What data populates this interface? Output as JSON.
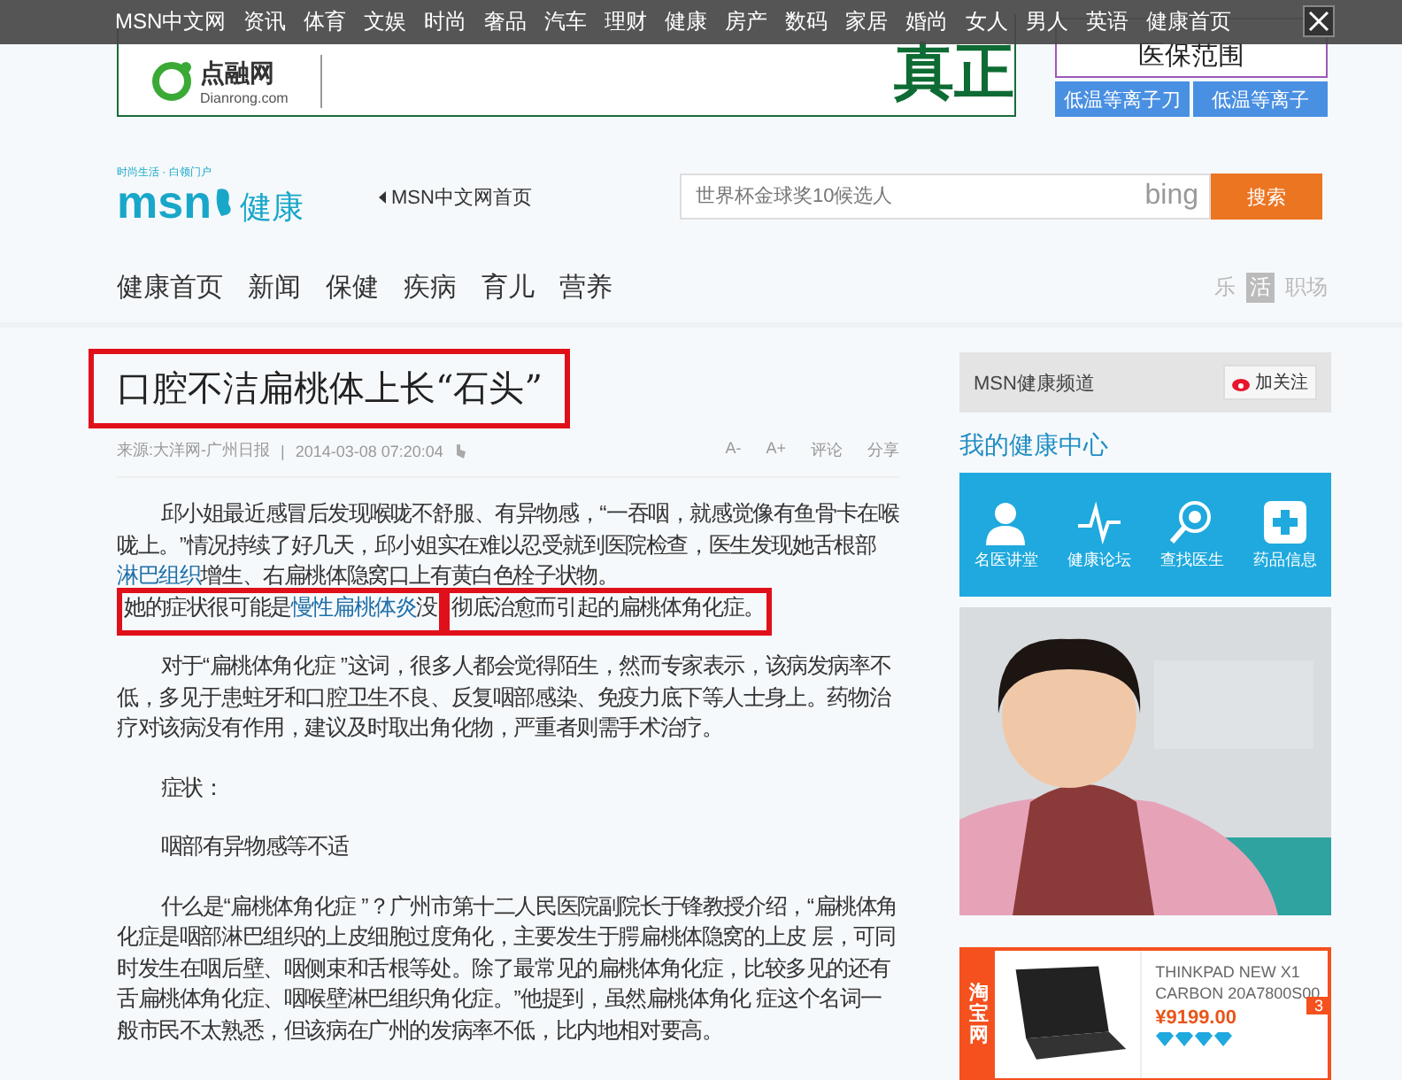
{
  "top_bar": {
    "links": [
      "MSN中文网",
      "资讯",
      "体育",
      "文娱",
      "时尚",
      "奢品",
      "汽车",
      "理财",
      "健康",
      "房产",
      "数码",
      "家居",
      "婚尚",
      "女人",
      "男人",
      "英语",
      "健康首页"
    ]
  },
  "ad_banner": {
    "brand": "点融网",
    "domain": "Dianrong.com",
    "headline": "真正"
  },
  "side_ad": {
    "title": "医保范围",
    "buttons": [
      "低温等离子刀",
      "低温等离子"
    ]
  },
  "header": {
    "tagline": "时尚生活 · 白领门户",
    "logo": "msn",
    "channel": "健康",
    "home_link": "MSN中文网首页",
    "search": {
      "placeholder": "世界杯金球奖10候选人",
      "engine": "bing",
      "button": "搜索"
    }
  },
  "nav": {
    "items": [
      "健康首页",
      "新闻",
      "保健",
      "疾病",
      "育儿",
      "营养"
    ],
    "tabs": [
      {
        "label": "乐",
        "selected": false
      },
      {
        "label": "活",
        "selected": true
      },
      {
        "label": "职场",
        "selected": false
      }
    ]
  },
  "article": {
    "title": {
      "text": "口腔不洁扁桃体上长“石头”",
      "marked": true
    },
    "source": "来源:大洋网-广州日报",
    "separator": "|",
    "date": "2014-03-08 07:20:04",
    "tools": [
      "A-",
      "A+",
      "评论",
      "分享"
    ],
    "paragraphs": [
      {
        "runs": [
          {
            "kind": "text",
            "text": "邱小姐最近感冒后发现喉咙不舒服、有异物感，“一吞咽，就感觉像有鱼骨卡在喉咙上。”情况持续了好几天，邱小姐实在难以忍受就到医院检查，医生发现她舌根部"
          },
          {
            "kind": "link",
            "text": "淋巴组织"
          },
          {
            "kind": "text",
            "text": "增生、右扁桃体隐窝口上有黄白色栓子状物。"
          },
          {
            "kind": "marked",
            "runs": [
              {
                "kind": "text",
                "text": "她的症状很可能是"
              },
              {
                "kind": "link",
                "text": "慢性扁桃体炎"
              },
              {
                "kind": "text",
                "text": "没"
              }
            ]
          },
          {
            "kind": "marked",
            "runs": [
              {
                "kind": "text",
                "text": "彻底治愈而引起的扁桃体角化症。"
              }
            ]
          }
        ]
      },
      {
        "runs": [
          {
            "kind": "text",
            "text": "对于“扁桃体角化症 ”这词，很多人都会觉得陌生，然而专家表示，该病发病率不低，多见于患蛀牙和口腔卫生不良、反复咽部感染、免疫力底下等人士身上。药物治疗对该病没有作用，建议及时取出角化物，严重者则需手术治疗。"
          }
        ]
      },
      {
        "runs": [
          {
            "kind": "text",
            "text": "症状："
          }
        ]
      },
      {
        "runs": [
          {
            "kind": "text",
            "text": "咽部有异物感等不适"
          }
        ]
      },
      {
        "runs": [
          {
            "kind": "text",
            "text": "什么是“扁桃体角化症 ”？广州市第十二人民医院副院长于锋教授介绍，“扁桃体角化症是咽部淋巴组织的上皮细胞过度角化，主要发生于腭扁桃体隐窝的上皮 层，可同时发生在咽后壁、咽侧束和舌根等处。除了最常见的扁桃体角化症，比较多见的还有舌扁桃体角化症、咽喉壁淋巴组织角化症。”他提到，虽然扁桃体角化 症这个名词一般市民不太熟悉，但该病在广州的发病率不低，比内地相对要高。"
          }
        ]
      }
    ]
  },
  "sidebar": {
    "channel": "MSN健康频道",
    "follow": "加关注",
    "center_title": "我的健康中心",
    "tools": [
      "名医讲堂",
      "健康论坛",
      "查找医生",
      "药品信息"
    ],
    "promo": {
      "kind": "picture"
    },
    "shop_ad": {
      "brand": "淘宝网",
      "product": "THINKPAD NEW X1 CARBON 20A7800S00",
      "price": "¥9199.00",
      "stars": 4,
      "page": "3"
    }
  }
}
